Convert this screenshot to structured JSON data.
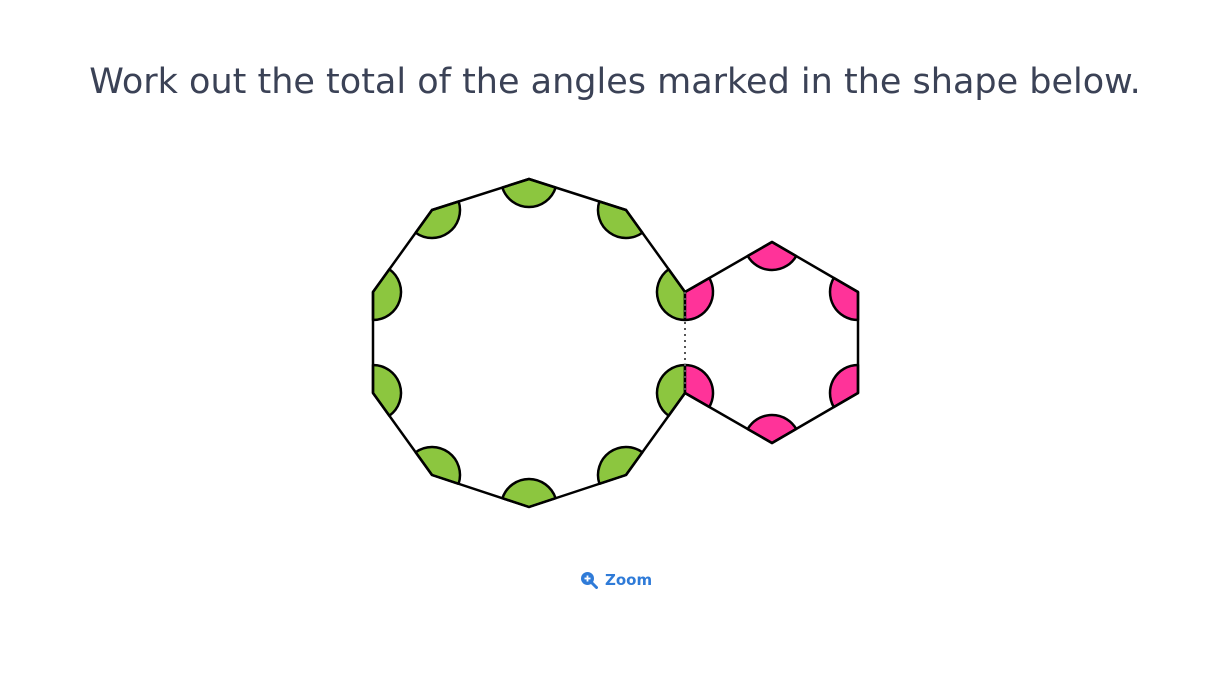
{
  "question": {
    "text": "Work out the total of the angles marked in the shape below."
  },
  "diagram": {
    "shapes": [
      {
        "name": "decagon",
        "sides": 10,
        "marked_angles": 10,
        "angle_color": "#8cc63f"
      },
      {
        "name": "hexagon",
        "sides": 6,
        "marked_angles": 6,
        "angle_color": "#ff3399"
      }
    ],
    "outline_color": "#000000",
    "shared_edge_style": "dotted"
  },
  "zoom": {
    "label": "Zoom",
    "icon": "zoom-in-icon",
    "color": "#2f7bd8"
  }
}
